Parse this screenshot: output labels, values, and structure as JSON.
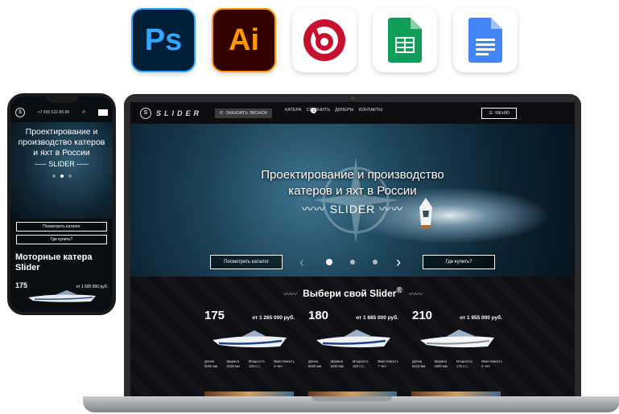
{
  "apps": [
    {
      "name": "photoshop",
      "label": "Ps"
    },
    {
      "name": "illustrator",
      "label": "Ai"
    },
    {
      "name": "odnoklassniki",
      "label": ""
    },
    {
      "name": "google-sheets",
      "label": ""
    },
    {
      "name": "google-docs",
      "label": ""
    }
  ],
  "phone": {
    "phone_number": "+7 495 532-86-86",
    "logo": "S",
    "hero_title": "Проектирование и производство катеров и яхт в России",
    "hero_brand": "----- SLIDER -----",
    "btn_catalog": "Посмотреть каталог",
    "btn_buy": "Где купить?",
    "section_heading": "Моторные катера Slider",
    "model_number": "175",
    "model_price": "от 1 695 000 руб."
  },
  "site": {
    "logo_letter": "S",
    "logo_word": "SLIDER",
    "call_button": "ЗАКАЗАТЬ ЗВОНОК",
    "nav": [
      "КАТЕРА",
      "СРАВНИТЬ",
      "ДИЛЕРЫ",
      "КОНТАКТЫ"
    ],
    "compare_count": "2",
    "menu_label": "МЕНЮ",
    "hero_title_line1": "Проектирование и производство",
    "hero_title_line2": "катеров и яхт в России",
    "hero_brand": "SLIDER",
    "btn_catalog": "Посмотреть каталог",
    "btn_buy": "Где купить?",
    "slide_index": 1,
    "slide_count": 3,
    "models_title": "Выбери свой Slider",
    "models_title_mark": "®",
    "spec_headers": [
      "Длина",
      "Ширина",
      "Мощность",
      "Вместимость"
    ],
    "models": [
      {
        "number": "175",
        "price": "от 1 265 000 руб.",
        "specs": [
          "5000 мм",
          "2100 мм",
          "100 л.с.",
          "5 чел"
        ]
      },
      {
        "number": "180",
        "price": "от 1 685 000 руб.",
        "specs": [
          "6020 мм",
          "2230 мм",
          "150 л.с.",
          "7 чел"
        ]
      },
      {
        "number": "210",
        "price": "от 1 955 000 руб.",
        "specs": [
          "6210 мм",
          "2300 мм",
          "175 л.с.",
          "8 чел"
        ]
      }
    ]
  },
  "colors": {
    "ps_blue": "#31a8ff",
    "ai_orange": "#ff9a00",
    "ok_red": "#c8102e",
    "sheets_green": "#0f9d58",
    "docs_blue": "#4285f4"
  }
}
